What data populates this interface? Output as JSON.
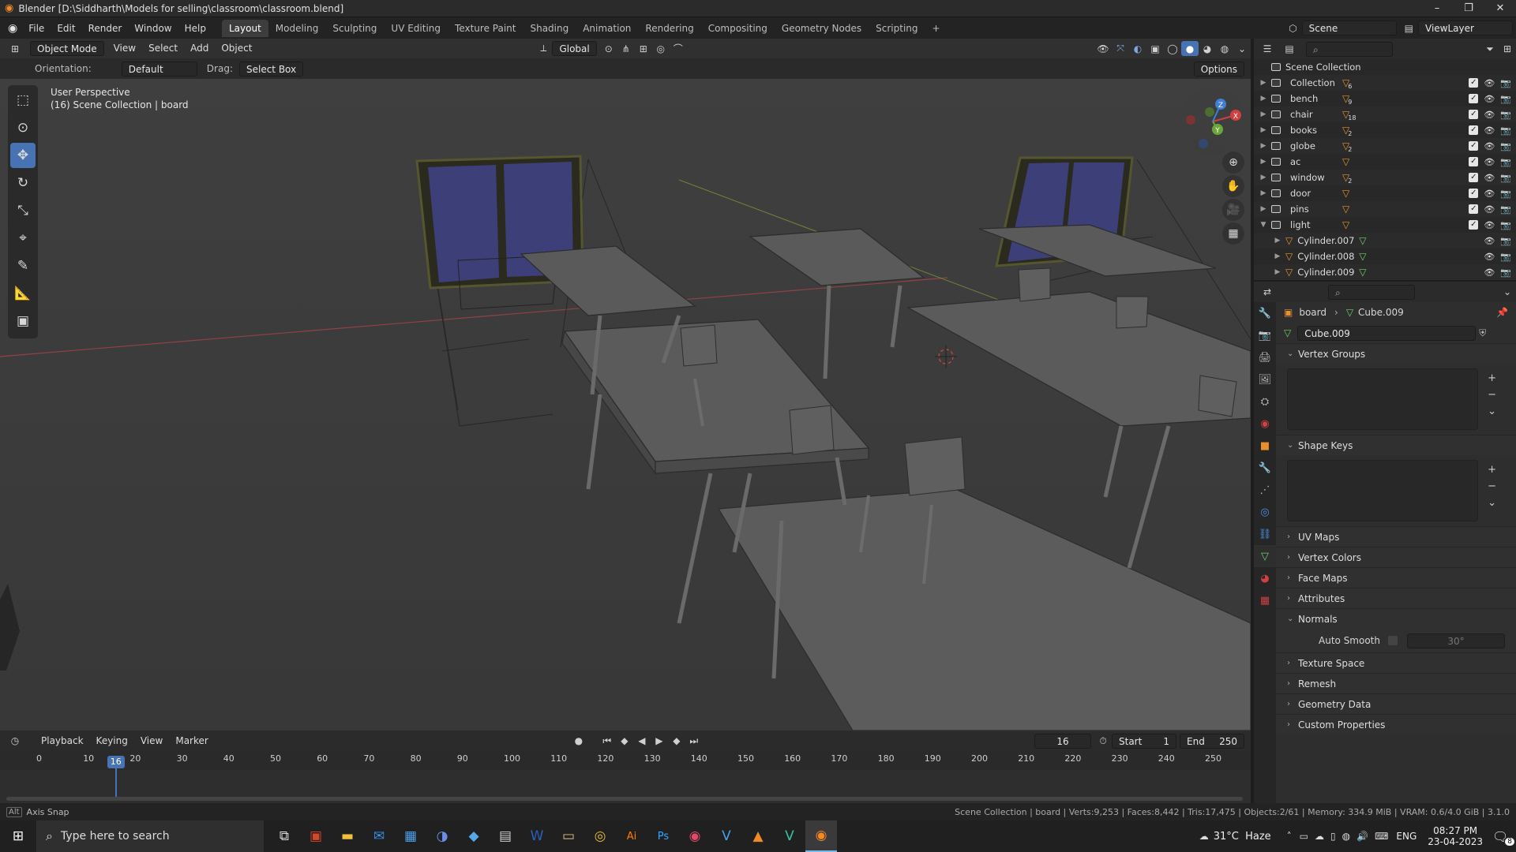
{
  "window": {
    "title": "Blender [D:\\Siddharth\\Models for selling\\classroom\\classroom.blend]",
    "min": "–",
    "max": "❐",
    "close": "✕"
  },
  "menu": {
    "items": [
      "File",
      "Edit",
      "Render",
      "Window",
      "Help"
    ]
  },
  "workspaces": [
    "Layout",
    "Modeling",
    "Sculpting",
    "UV Editing",
    "Texture Paint",
    "Shading",
    "Animation",
    "Rendering",
    "Compositing",
    "Geometry Nodes",
    "Scripting",
    "+"
  ],
  "scene": {
    "label": "Scene",
    "view_layer": "ViewLayer"
  },
  "header3d": {
    "mode": "Object Mode",
    "view": "View",
    "select": "Select",
    "add": "Add",
    "object": "Object",
    "transform": "Global",
    "options": "Options"
  },
  "subheader": {
    "orientation_label": "Orientation:",
    "orientation_value": "Default",
    "drag_label": "Drag:",
    "drag_value": "Select Box"
  },
  "viewport": {
    "perspective": "User Perspective",
    "context": "(16) Scene Collection | board"
  },
  "gizmo": {
    "x": "X",
    "y": "Y",
    "z": "Z"
  },
  "outliner": {
    "root": "Scene Collection",
    "rows": [
      {
        "name": "Collection",
        "count": "6",
        "level": 0,
        "expanded": false
      },
      {
        "name": "bench",
        "count": "9",
        "level": 0,
        "expanded": false
      },
      {
        "name": "chair",
        "count": "18",
        "level": 0,
        "expanded": false
      },
      {
        "name": "books",
        "count": "2",
        "level": 0,
        "expanded": false
      },
      {
        "name": "globe",
        "count": "2",
        "level": 0,
        "expanded": false
      },
      {
        "name": "ac",
        "count": "",
        "level": 0,
        "expanded": false
      },
      {
        "name": "window",
        "count": "2",
        "level": 0,
        "expanded": false
      },
      {
        "name": "door",
        "count": "",
        "level": 0,
        "expanded": false
      },
      {
        "name": "pins",
        "count": "",
        "level": 0,
        "expanded": false
      },
      {
        "name": "light",
        "count": "",
        "level": 0,
        "expanded": true
      },
      {
        "name": "Cylinder.007",
        "count": "",
        "level": 1,
        "expanded": false
      },
      {
        "name": "Cylinder.008",
        "count": "",
        "level": 1,
        "expanded": false
      },
      {
        "name": "Cylinder.009",
        "count": "",
        "level": 1,
        "expanded": false
      }
    ]
  },
  "properties": {
    "breadcrumb_object": "board",
    "breadcrumb_data": "Cube.009",
    "data_name": "Cube.009",
    "sections": {
      "vertex_groups": "Vertex Groups",
      "shape_keys": "Shape Keys",
      "uv_maps": "UV Maps",
      "vertex_colors": "Vertex Colors",
      "face_maps": "Face Maps",
      "attributes": "Attributes",
      "normals": "Normals",
      "auto_smooth": "Auto Smooth",
      "auto_smooth_angle": "30°",
      "texture_space": "Texture Space",
      "remesh": "Remesh",
      "geometry_data": "Geometry Data",
      "custom_properties": "Custom Properties"
    }
  },
  "timeline": {
    "menus": [
      "Playback",
      "Keying",
      "View",
      "Marker"
    ],
    "current_frame": "16",
    "start_label": "Start",
    "start": "1",
    "end_label": "End",
    "end": "250",
    "ticks": [
      "0",
      "10",
      "20",
      "30",
      "40",
      "50",
      "60",
      "70",
      "80",
      "90",
      "100",
      "110",
      "120",
      "130",
      "140",
      "150",
      "160",
      "170",
      "180",
      "190",
      "200",
      "210",
      "220",
      "230",
      "240",
      "250"
    ]
  },
  "status": {
    "left": "Axis Snap",
    "right": "Scene Collection | board | Verts:9,253 | Faces:8,442 | Tris:17,475 | Objects:2/61 | Memory: 334.9 MiB | VRAM: 0.6/4.0 GiB | 3.1.0"
  },
  "taskbar": {
    "search_placeholder": "Type here to search",
    "weather": "31°C  Haze",
    "lang": "ENG",
    "time": "08:27 PM",
    "date": "23-04-2023",
    "notif": "8"
  },
  "colors": {
    "accent": "#4772b3",
    "mesh_icon": "#e8902e",
    "data_icon": "#6bd26b",
    "window_glass": "#3d3f78"
  }
}
